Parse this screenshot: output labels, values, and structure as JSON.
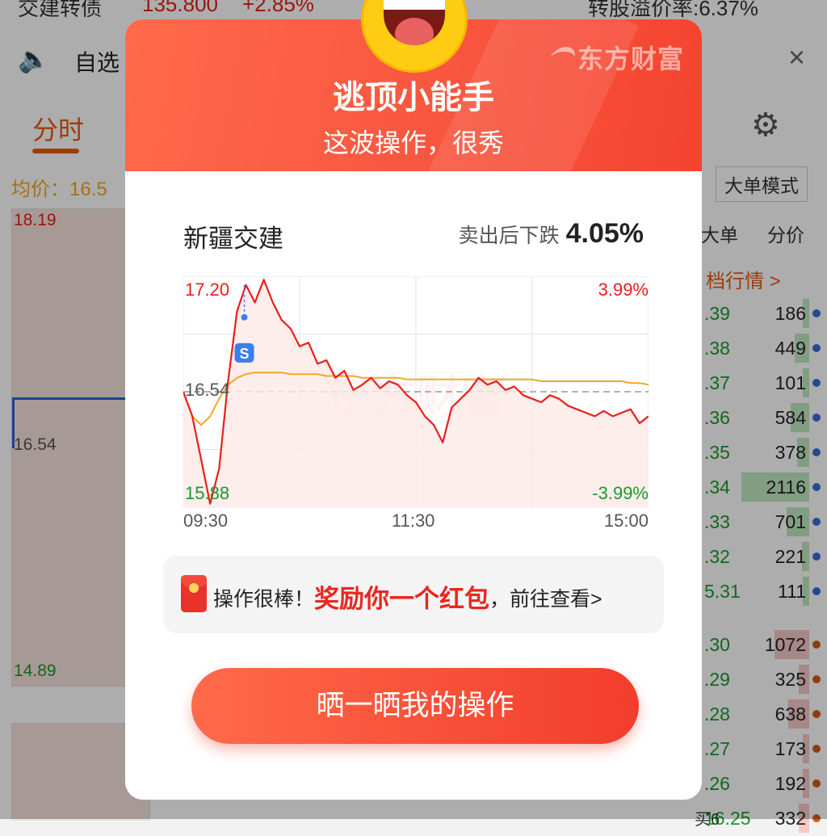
{
  "background": {
    "top_bar": {
      "left": "交建转债",
      "left_value": "135.800",
      "left_pct": "+2.85%",
      "right": "转股溢价率:6.37%"
    },
    "notice": {
      "text": "自选",
      "close": "×"
    },
    "tabs": {
      "active": "分时",
      "button": "大单模式"
    },
    "avg_label": "均价：16.5",
    "chart_labels": {
      "high": "18.19",
      "mid": "16.54",
      "low": "14.89"
    },
    "orderbook_headers": [
      "大单",
      "分价"
    ],
    "orderbook_link": "档行情 >",
    "sell_rows": [
      {
        "price": ".39",
        "vol": "186"
      },
      {
        "price": ".38",
        "vol": "449"
      },
      {
        "price": ".37",
        "vol": "101"
      },
      {
        "price": ".36",
        "vol": "584"
      },
      {
        "price": ".35",
        "vol": "378"
      },
      {
        "price": ".34",
        "vol": "2116"
      },
      {
        "price": ".33",
        "vol": "701"
      },
      {
        "price": ".32",
        "vol": "221"
      },
      {
        "price": "5.31",
        "vol": "111"
      }
    ],
    "buy_rows": [
      {
        "price": ".30",
        "vol": "1072"
      },
      {
        "price": ".29",
        "vol": "325"
      },
      {
        "price": ".28",
        "vol": "638"
      },
      {
        "price": ".27",
        "vol": "173"
      },
      {
        "price": ".26",
        "vol": "192"
      },
      {
        "price": "16.25",
        "vol": "332"
      }
    ],
    "buy_tag": "买6"
  },
  "popup": {
    "brand": "东方财富",
    "title": "逃顶小能手",
    "subtitle": "这波操作，很秀",
    "stock_name": "新疆交建",
    "change_label": "卖出后下跌",
    "change_value": "4.05%",
    "reward_prefix": "操作很棒！",
    "reward_highlight": "奖励你一个红包",
    "reward_suffix": "，前往查看>",
    "share_button": "晒一晒我的操作",
    "sell_marker": "S",
    "watermark": "东方财富"
  },
  "chart_data": {
    "type": "line",
    "x_ticks": [
      "09:30",
      "11:30",
      "15:00"
    ],
    "y_left": {
      "high": "17.20",
      "mid": "16.54",
      "low": "15.88"
    },
    "y_right": {
      "high": "3.99%",
      "low": "-3.99%"
    },
    "ylim": [
      15.88,
      17.2
    ],
    "prev_close": 16.54,
    "series": [
      {
        "values": [
          16.54,
          16.4,
          16.15,
          15.9,
          16.1,
          16.6,
          17.0,
          17.15,
          17.05,
          17.18,
          17.05,
          16.95,
          16.9,
          16.8,
          16.82,
          16.7,
          16.72,
          16.62,
          16.66,
          16.55,
          16.58,
          16.62,
          16.56,
          16.6,
          16.58,
          16.52,
          16.48,
          16.4,
          16.35,
          16.25,
          16.45,
          16.5,
          16.55,
          16.62,
          16.58,
          16.6,
          16.55,
          16.57,
          16.52,
          16.5,
          16.48,
          16.52,
          16.5,
          16.46,
          16.44,
          16.42,
          16.4,
          16.43,
          16.4,
          16.42,
          16.44,
          16.36,
          16.4
        ]
      },
      {
        "values": [
          16.54,
          16.4,
          16.35,
          16.4,
          16.5,
          16.58,
          16.62,
          16.64,
          16.65,
          16.65,
          16.65,
          16.65,
          16.64,
          16.64,
          16.64,
          16.64,
          16.63,
          16.63,
          16.63,
          16.63,
          16.62,
          16.62,
          16.62,
          16.62,
          16.62,
          16.61,
          16.61,
          16.61,
          16.61,
          16.61,
          16.61,
          16.61,
          16.61,
          16.61,
          16.61,
          16.61,
          16.61,
          16.61,
          16.61,
          16.61,
          16.6,
          16.6,
          16.6,
          16.6,
          16.6,
          16.6,
          16.6,
          16.6,
          16.6,
          16.6,
          16.59,
          16.59,
          16.58
        ]
      }
    ],
    "colors": {
      "price": "#e8201a",
      "avg": "#f5a623",
      "fill": "#fde8e6",
      "up": "#e8201a",
      "down": "#1a9a2a"
    }
  }
}
